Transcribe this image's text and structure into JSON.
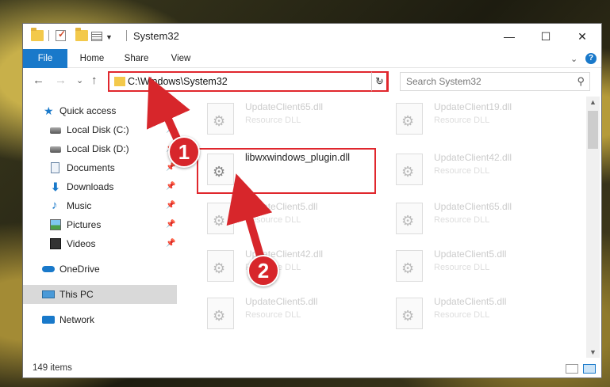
{
  "window": {
    "title": "System32",
    "controls": {
      "minimize": "—",
      "maximize": "☐",
      "close": "✕"
    }
  },
  "ribbon": {
    "tabs": [
      "File",
      "Home",
      "Share",
      "View"
    ],
    "collapse": "⌄",
    "help": "?"
  },
  "nav": {
    "back": "←",
    "forward": "→",
    "recent": "⌄",
    "up": "↑",
    "address": "C:\\Windows\\System32",
    "address_dropdown": "⌄",
    "refresh": "↻",
    "search_placeholder": "Search System32",
    "search_icon": "⚲"
  },
  "sidebar": {
    "items": [
      {
        "label": "Quick access",
        "icon": "star-icon",
        "pinned": false
      },
      {
        "label": "Local Disk (C:)",
        "icon": "disk-icon",
        "pinned": true
      },
      {
        "label": "Local Disk (D:)",
        "icon": "disk-icon",
        "pinned": true
      },
      {
        "label": "Documents",
        "icon": "document-icon",
        "pinned": true
      },
      {
        "label": "Downloads",
        "icon": "download-icon",
        "pinned": true
      },
      {
        "label": "Music",
        "icon": "music-icon",
        "pinned": true
      },
      {
        "label": "Pictures",
        "icon": "pictures-icon",
        "pinned": true
      },
      {
        "label": "Videos",
        "icon": "videos-icon",
        "pinned": true
      },
      {
        "label": "OneDrive",
        "icon": "cloud-icon",
        "pinned": false
      },
      {
        "label": "This PC",
        "icon": "computer-icon",
        "pinned": false
      },
      {
        "label": "Network",
        "icon": "network-icon",
        "pinned": false
      }
    ],
    "pin_glyph": "📌"
  },
  "files": [
    {
      "name": "UpdateClient65.dll",
      "type": "Resource DLL"
    },
    {
      "name": "UpdateClient19.dll",
      "type": "Resource DLL"
    },
    {
      "name": "libwxwindows_plugin.dll",
      "type": ""
    },
    {
      "name": "UpdateClient42.dll",
      "type": "Resource DLL"
    },
    {
      "name": "UpdateClient5.dll",
      "type": "Resource DLL"
    },
    {
      "name": "UpdateClient65.dll",
      "type": "Resource DLL"
    },
    {
      "name": "UpdateClient42.dll",
      "type": "Resource DLL"
    },
    {
      "name": "UpdateClient5.dll",
      "type": "Resource DLL"
    },
    {
      "name": "UpdateClient5.dll",
      "type": "Resource DLL"
    },
    {
      "name": "UpdateClient5.dll",
      "type": "Resource DLL"
    }
  ],
  "status": {
    "item_count": "149 items"
  },
  "annotations": {
    "badge1": "1",
    "badge2": "2"
  },
  "colors": {
    "accent": "#1979ca",
    "highlight": "#e0272d"
  }
}
